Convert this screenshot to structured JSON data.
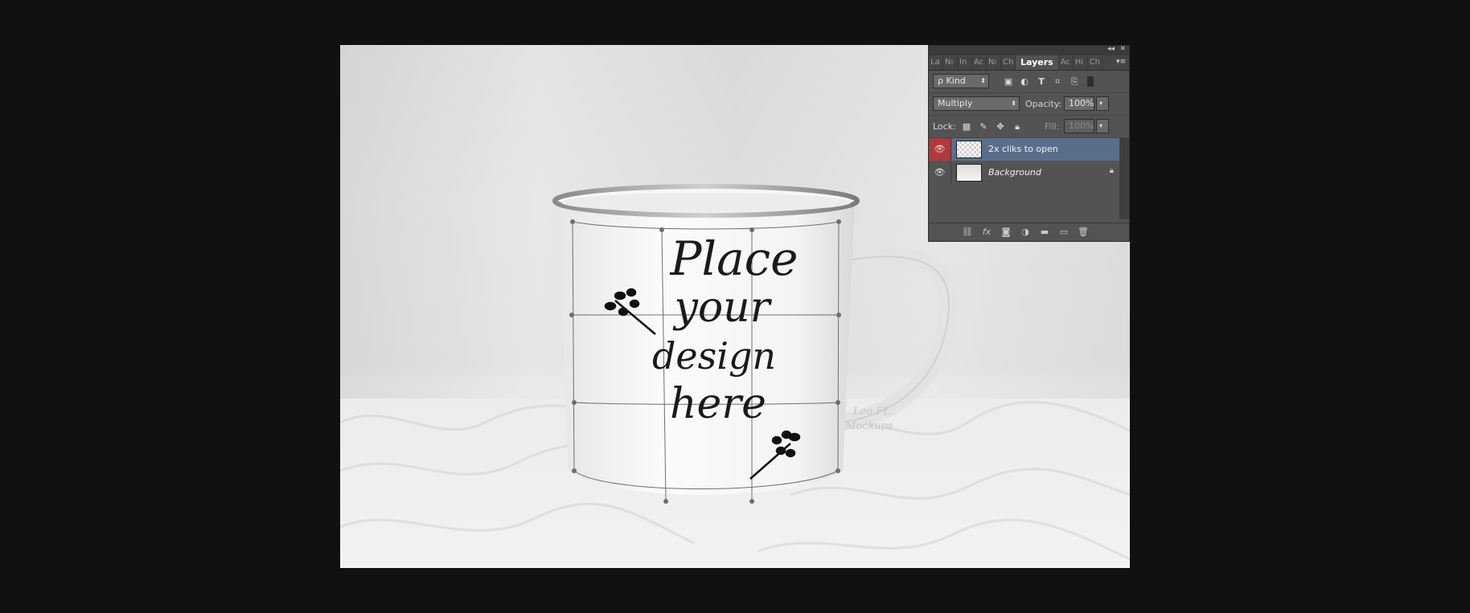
{
  "panel": {
    "title_bar": {
      "collapse_icon": "double-chevron-left-icon",
      "close_icon": "close-icon"
    },
    "tabs": [
      {
        "label": "La"
      },
      {
        "label": "Nı"
      },
      {
        "label": "In"
      },
      {
        "label": "Ac"
      },
      {
        "label": "Nı"
      },
      {
        "label": "Ch"
      },
      {
        "label": "Layers"
      },
      {
        "label": "Ac"
      },
      {
        "label": "Hi"
      },
      {
        "label": "Ch"
      }
    ],
    "filter": {
      "kind_label": "ρ Kind"
    },
    "blend": {
      "mode": "Multiply",
      "opacity_label": "Opacity:",
      "opacity_value": "100%"
    },
    "lock": {
      "label": "Lock:",
      "fill_label": "Fill:",
      "fill_value": "100%"
    },
    "layers": [
      {
        "name": "2x cliks to open",
        "selected": true
      },
      {
        "name": "Background",
        "selected": false,
        "locked": true
      }
    ]
  },
  "canvas": {
    "mug_text": [
      "Place",
      "your",
      "design",
      "here"
    ],
    "watermark": [
      "Leo FL",
      "Mockups"
    ]
  },
  "colors": {
    "app_bg": "#111111",
    "panel_bg": "#535353",
    "selected_layer": "#5a6e8c",
    "eye_active": "#b0393b"
  }
}
